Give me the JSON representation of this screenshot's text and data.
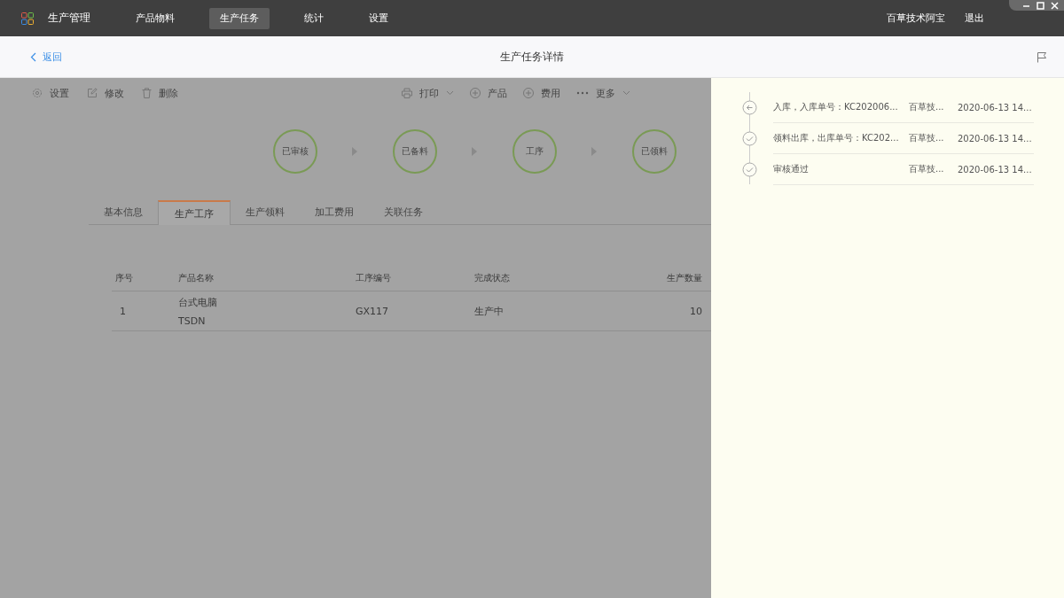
{
  "app": {
    "title": "生产管理"
  },
  "nav": [
    {
      "label": "产品物料",
      "selected": false
    },
    {
      "label": "生产任务",
      "selected": true
    },
    {
      "label": "统计",
      "selected": false
    },
    {
      "label": "设置",
      "selected": false
    }
  ],
  "user": {
    "name": "百草技术阿宝",
    "logout": "退出"
  },
  "header": {
    "back": "返回",
    "title": "生产任务详情"
  },
  "toolbar_left": [
    {
      "label": "设置",
      "kind": "gear"
    },
    {
      "label": "修改",
      "kind": "edit"
    },
    {
      "label": "删除",
      "kind": "trash"
    }
  ],
  "toolbar_right": [
    {
      "label": "打印",
      "kind": "printer",
      "dropdown": true
    },
    {
      "label": "产品",
      "kind": "plus",
      "dropdown": false
    },
    {
      "label": "费用",
      "kind": "plus",
      "dropdown": false
    },
    {
      "label": "更多",
      "kind": "dots",
      "dropdown": true
    }
  ],
  "steps": [
    "已审核",
    "已备料",
    "工序",
    "已领料"
  ],
  "tabs": [
    {
      "label": "基本信息",
      "selected": false
    },
    {
      "label": "生产工序",
      "selected": true
    },
    {
      "label": "生产领料",
      "selected": false
    },
    {
      "label": "加工费用",
      "selected": false
    },
    {
      "label": "关联任务",
      "selected": false
    }
  ],
  "table": {
    "columns": [
      "序号",
      "产品名称",
      "工序编号",
      "完成状态",
      "生产数量"
    ],
    "rows": [
      {
        "index": "1",
        "product": [
          "台式电脑",
          "TSDN"
        ],
        "process_no": "GX117",
        "status": "生产中",
        "quantity": "10"
      }
    ]
  },
  "timeline": [
    {
      "kind": "arrow",
      "text": "入库，入库单号：KC202006...",
      "user": "百草技...",
      "time": "2020-06-13 14..."
    },
    {
      "kind": "check",
      "text": "领料出库，出库单号：KC202...",
      "user": "百草技...",
      "time": "2020-06-13 14..."
    },
    {
      "kind": "check",
      "text": "审核通过",
      "user": "百草技...",
      "time": "2020-06-13 14..."
    }
  ]
}
